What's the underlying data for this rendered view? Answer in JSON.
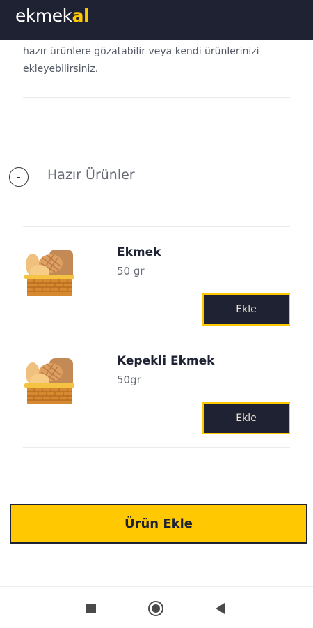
{
  "app": {
    "logo_main": "ekmek",
    "logo_accent": "al"
  },
  "intro_text": "hazır ürünlere gözatabilir veya kendi ürünlerinizi ekleyebilirsiniz.",
  "section": {
    "title": "Hazır Ürünler",
    "toggle_symbol": "-"
  },
  "products": [
    {
      "name": "Ekmek",
      "weight": "50 gr",
      "add_label": "Ekle",
      "icon": "bread-basket-icon"
    },
    {
      "name": "Kepekli Ekmek",
      "weight": "50gr",
      "add_label": "Ekle",
      "icon": "bread-basket-icon"
    }
  ],
  "submit_label": "Ürün Ekle",
  "colors": {
    "brand_dark": "#1f2233",
    "accent_yellow": "#ffc800"
  },
  "system_nav": {
    "recents_icon": "square-icon",
    "home_icon": "circle-icon",
    "back_icon": "triangle-back-icon"
  }
}
